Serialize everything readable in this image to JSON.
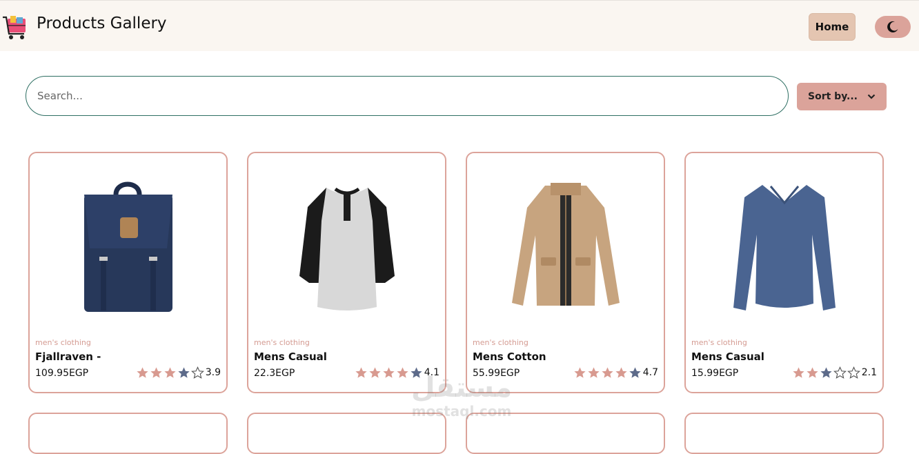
{
  "navbar": {
    "brand_title": "Products Gallery",
    "home_label": "Home",
    "logo_icon": "shopping-cart-icon",
    "theme_icon": "moon-icon"
  },
  "search": {
    "placeholder": "Search..."
  },
  "sort": {
    "label": "Sort by...",
    "icon": "chevron-down-icon"
  },
  "products": [
    {
      "category": "men's clothing",
      "title": "Fjallraven -",
      "price": "109.95EGP",
      "rating_text": "3.9",
      "rating": 3.9,
      "image_icon": "backpack-icon"
    },
    {
      "category": "men's clothing",
      "title": "Mens Casual",
      "price": "22.3EGP",
      "rating_text": "4.1",
      "rating": 4.1,
      "image_icon": "raglan-shirt-icon"
    },
    {
      "category": "men's clothing",
      "title": "Mens Cotton",
      "price": "55.99EGP",
      "rating_text": "4.7",
      "rating": 4.7,
      "image_icon": "jacket-icon"
    },
    {
      "category": "men's clothing",
      "title": "Mens Casual",
      "price": "15.99EGP",
      "rating_text": "2.1",
      "rating": 2.1,
      "image_icon": "long-sleeve-shirt-icon"
    }
  ],
  "watermark": {
    "arabic": "مستقل",
    "latin": "mostaql.com"
  },
  "colors": {
    "accent": "#dba39a",
    "star_filled": "#d89a90",
    "star_half": "#5d6b8a",
    "border": "#dca39a",
    "search_border": "#2d6e62"
  }
}
